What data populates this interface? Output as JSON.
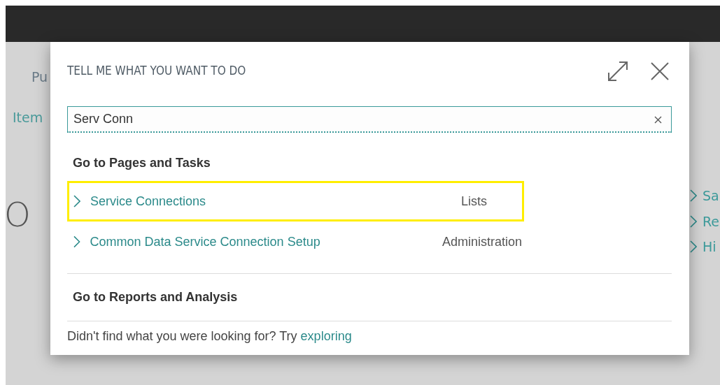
{
  "background": {
    "nav_items": [
      "Pu",
      "Item"
    ],
    "heading": "O",
    "side_links": [
      "Sa",
      "Re",
      "Hi"
    ]
  },
  "dialog": {
    "title": "TELL ME WHAT YOU WANT TO DO",
    "search": {
      "value": "Serv Conn"
    },
    "sections": [
      {
        "heading": "Go to Pages and Tasks",
        "results": [
          {
            "name": "Service Connections",
            "category": "Lists",
            "selected": true
          },
          {
            "name": "Common Data Service Connection Setup",
            "category": "Administration",
            "selected": false
          }
        ]
      },
      {
        "heading": "Go to Reports and Analysis"
      }
    ],
    "footer": {
      "text": "Didn't find what you were looking for? Try",
      "link": "exploring"
    }
  }
}
